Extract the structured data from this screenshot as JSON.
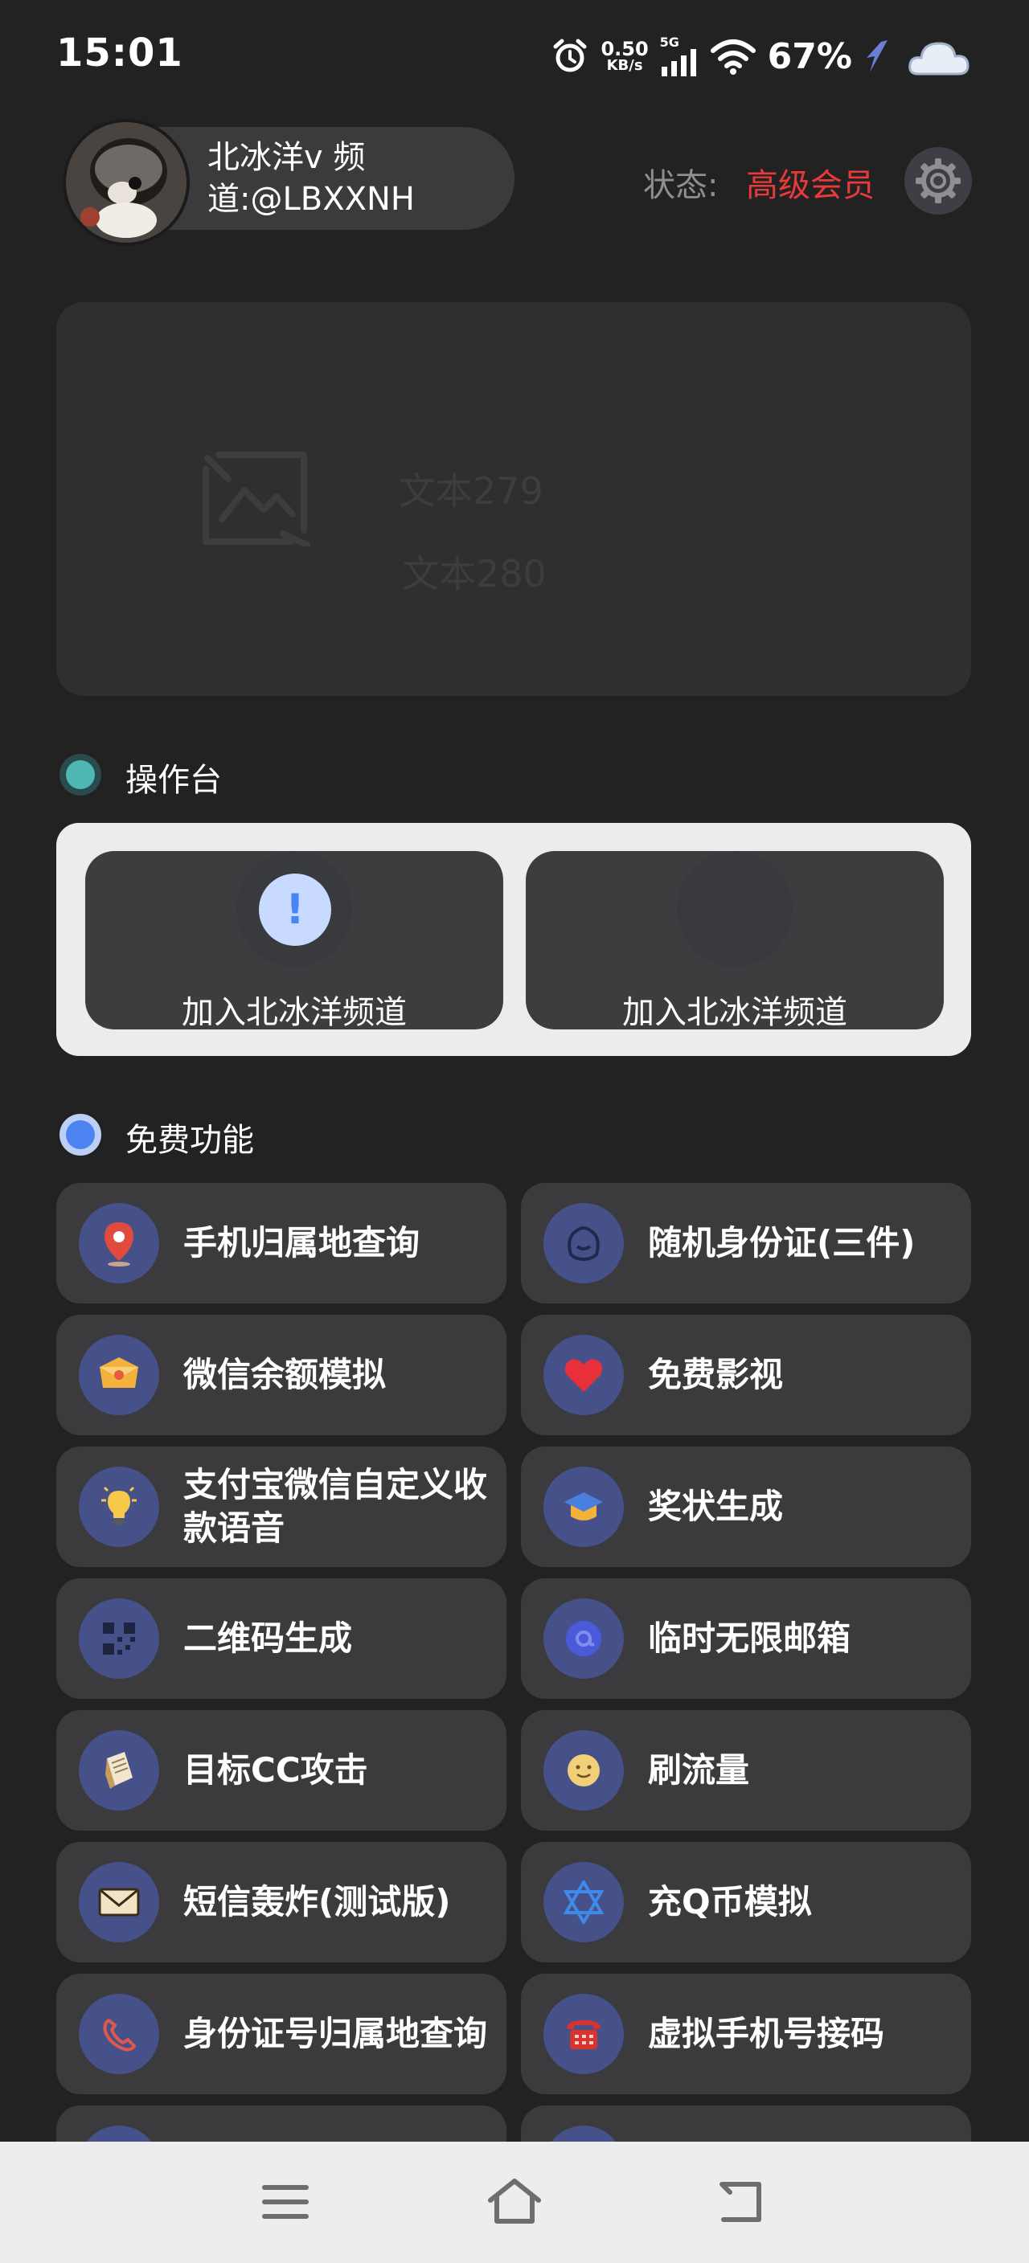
{
  "status_bar": {
    "time": "15:01",
    "net_speed_value": "0.50",
    "net_speed_unit": "KB/s",
    "network_type": "5G",
    "battery": "67%"
  },
  "header": {
    "profile_name": "北冰洋v 频道:@LBXXNH",
    "status_label": "状态:",
    "status_value": "高级会员",
    "status_color": "#e8393b"
  },
  "banner": {
    "text1": "文本279",
    "text2": "文本280"
  },
  "console_section": {
    "title": "操作台",
    "buttons": [
      {
        "label": "加入北冰洋频道",
        "icon": "exclamation-icon",
        "icon_glyph": "!"
      },
      {
        "label": "加入北冰洋频道",
        "icon": "blank-icon",
        "icon_glyph": ""
      }
    ]
  },
  "free_section": {
    "title": "免费功能",
    "items": [
      {
        "label": "手机归属地查询",
        "icon": "location-pin-icon"
      },
      {
        "label": "随机身份证(三件)",
        "icon": "person-outline-icon"
      },
      {
        "label": "微信余额模拟",
        "icon": "wallet-icon"
      },
      {
        "label": "免费影视",
        "icon": "heart-icon"
      },
      {
        "label": "支付宝微信自定义收款语音",
        "icon": "lightbulb-icon"
      },
      {
        "label": "奖状生成",
        "icon": "graduation-cap-icon"
      },
      {
        "label": "二维码生成",
        "icon": "qr-code-icon"
      },
      {
        "label": "临时无限邮箱",
        "icon": "email-at-icon"
      },
      {
        "label": "目标CC攻击",
        "icon": "document-icon"
      },
      {
        "label": "刷流量",
        "icon": "smiley-icon"
      },
      {
        "label": "短信轰炸(测试版)",
        "icon": "envelope-icon"
      },
      {
        "label": "充Q币模拟",
        "icon": "star-of-david-icon"
      },
      {
        "label": "身份证号归属地查询",
        "icon": "phone-handset-icon"
      },
      {
        "label": "虚拟手机号接码",
        "icon": "telephone-icon"
      }
    ]
  },
  "nav_bar": {
    "menu": "menu-icon",
    "home": "home-icon",
    "back": "back-icon"
  }
}
